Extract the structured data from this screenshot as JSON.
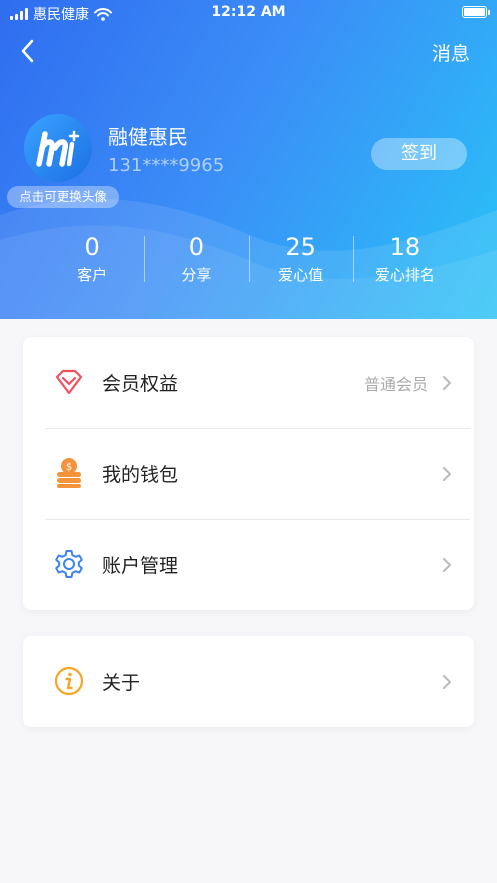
{
  "status_bar": {
    "carrier": "惠民健康",
    "time": "12:12 AM"
  },
  "header": {
    "message_label": "消息",
    "avatar_tip": "点击可更换头像",
    "username": "融健惠民",
    "phone": "131****9965",
    "signin_label": "签到"
  },
  "stats": [
    {
      "value": "0",
      "label": "客户"
    },
    {
      "value": "0",
      "label": "分享"
    },
    {
      "value": "25",
      "label": "爱心值"
    },
    {
      "value": "18",
      "label": "爱心排名"
    }
  ],
  "menu": {
    "membership": {
      "label": "会员权益",
      "value": "普通会员",
      "icon": "diamond-icon"
    },
    "wallet": {
      "label": "我的钱包",
      "icon": "coins-icon"
    },
    "account": {
      "label": "账户管理",
      "icon": "gear-icon"
    },
    "about": {
      "label": "关于",
      "icon": "info-icon"
    }
  },
  "colors": {
    "header_start": "#2f6df0",
    "header_end": "#29c3f7",
    "diamond": "#f0515f",
    "coins": "#f5933a",
    "gear": "#3d84f0",
    "info": "#f5a623"
  }
}
